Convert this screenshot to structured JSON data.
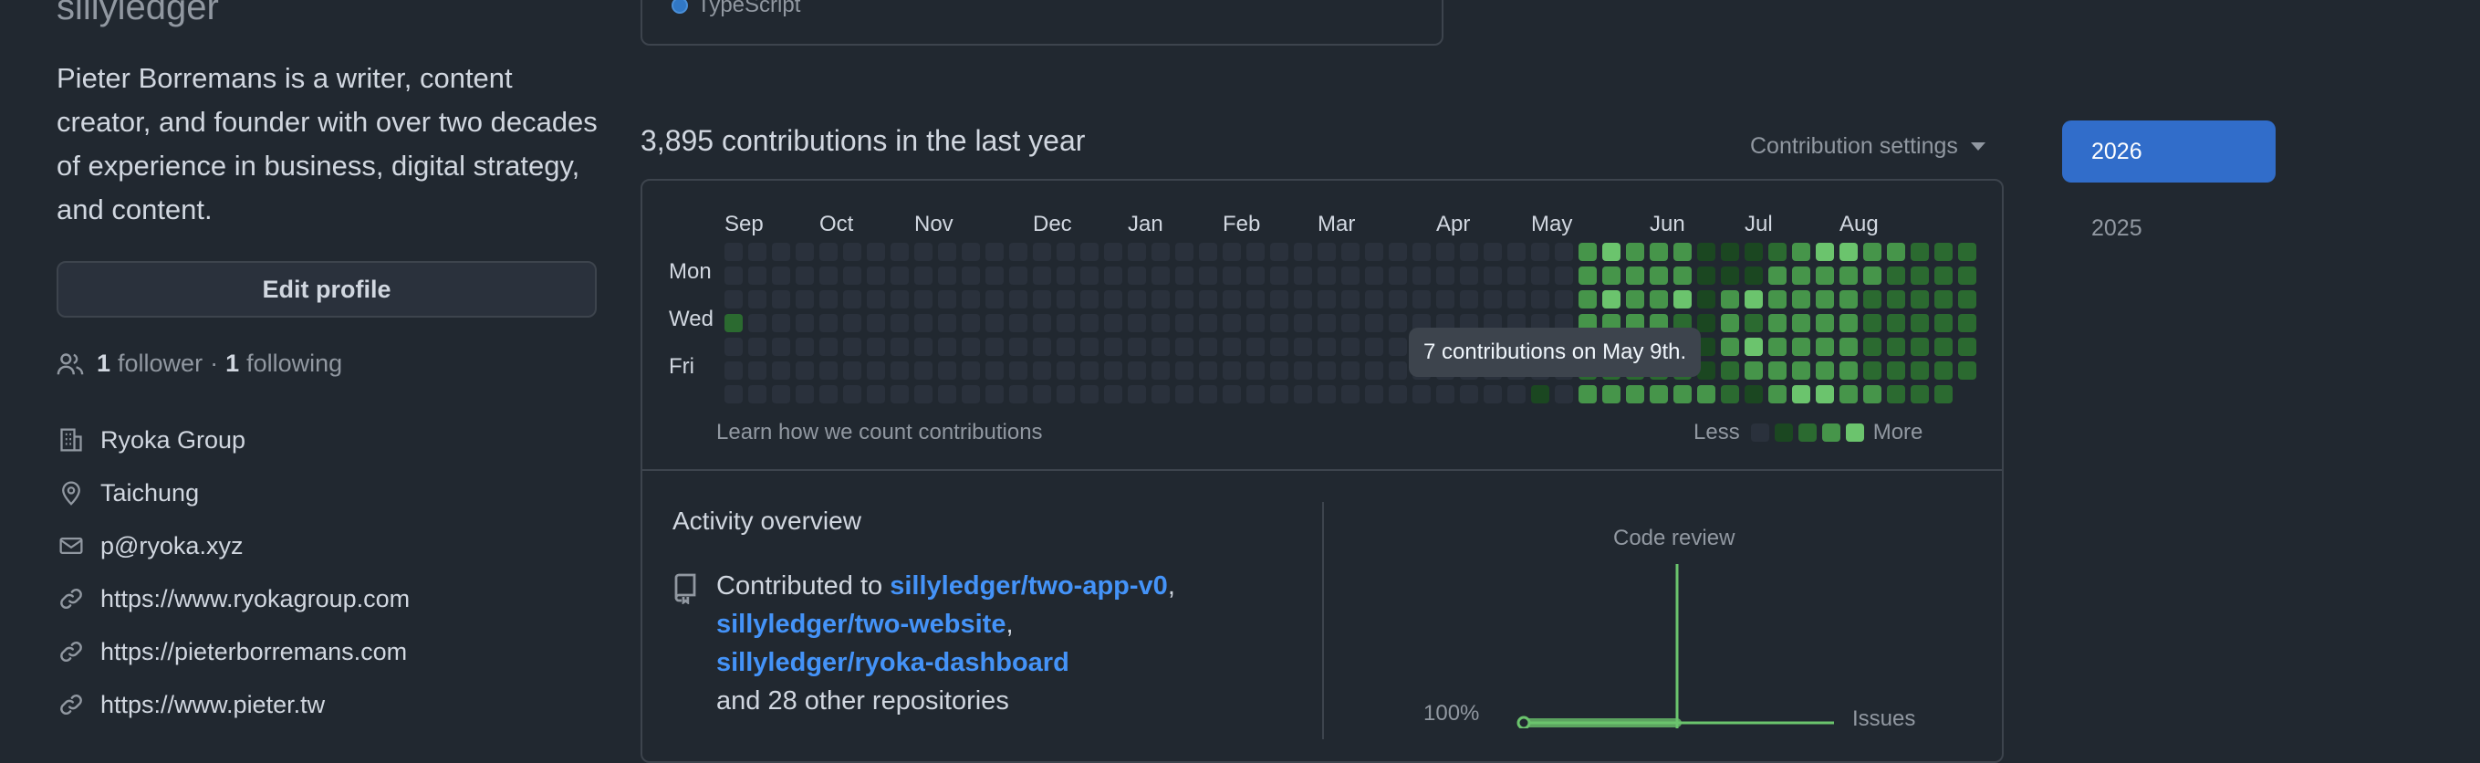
{
  "profile": {
    "username": "sillyledger",
    "bio": "Pieter Borremans is a writer, content creator, and founder with over two decades of experience in business, digital strategy, and content.",
    "edit_button": "Edit profile",
    "followers_count": "1",
    "followers_label": "follower",
    "following_count": "1",
    "following_label": "following",
    "separator": "·",
    "company": "Ryoka Group",
    "location": "Taichung",
    "email": "p@ryoka.xyz",
    "links": [
      "https://www.ryokagroup.com",
      "https://pieterborremans.com",
      "https://www.pieter.tw"
    ]
  },
  "languages": {
    "items": [
      {
        "name": "TypeScript",
        "color": "#3178c6"
      }
    ]
  },
  "contributions": {
    "title": "3,895 contributions in the last year",
    "settings_label": "Contribution settings",
    "months": [
      "Sep",
      "Oct",
      "Nov",
      "Dec",
      "Jan",
      "Feb",
      "Mar",
      "Apr",
      "May",
      "Jun",
      "Jul",
      "Aug"
    ],
    "days": [
      "Mon",
      "Wed",
      "Fri"
    ],
    "learn_link": "Learn how we count contributions",
    "legend_less": "Less",
    "legend_more": "More",
    "level_colors": [
      "#2a313c",
      "#1b4721",
      "#2b6a30",
      "#46954a",
      "#6bc46d"
    ],
    "tooltip": "7 contributions on May 9th."
  },
  "activity": {
    "title": "Activity overview",
    "contributed_prefix": "Contributed to",
    "repos": [
      "sillyledger/two-app-v0",
      "sillyledger/two-website",
      "sillyledger/ryoka-dashboard"
    ],
    "others_text": "and 28 other repositories",
    "axis_top": "Code review",
    "axis_right": "Issues",
    "axis_pct": "100%"
  },
  "years": {
    "active": "2026",
    "other": "2025"
  }
}
